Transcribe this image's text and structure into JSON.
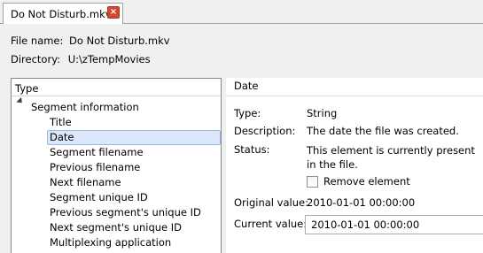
{
  "tab": {
    "label": "Do Not Disturb.mkv",
    "close_glyph": "×"
  },
  "info": {
    "file_name_label": "File name:",
    "file_name": "Do Not Disturb.mkv",
    "directory_label": "Directory:",
    "directory": "U:\\zTempMovies"
  },
  "tree": {
    "header": "Type",
    "parent": "Segment information",
    "items": [
      "Title",
      "Date",
      "Segment filename",
      "Previous filename",
      "Next filename",
      "Segment unique ID",
      "Previous segment's unique ID",
      "Next segment's unique ID",
      "Multiplexing application"
    ],
    "selected": "Date"
  },
  "detail": {
    "title": "Date",
    "type_label": "Type:",
    "type_value": "String",
    "description_label": "Description:",
    "description_value": "The date the file was created.",
    "status_label": "Status:",
    "status_value": "This element is currently present in the file.",
    "remove_label": "Remove element",
    "original_label": "Original value:",
    "original_value": "2010-01-01 00:00:00",
    "current_label": "Current value:",
    "current_value": "2010-01-01 00:00:00"
  },
  "colors": {
    "selection_bg": "#dbe8f9",
    "selection_border": "#98b7e6",
    "close_button": "#d9442c",
    "panel_bg": "#f0f0f0"
  }
}
